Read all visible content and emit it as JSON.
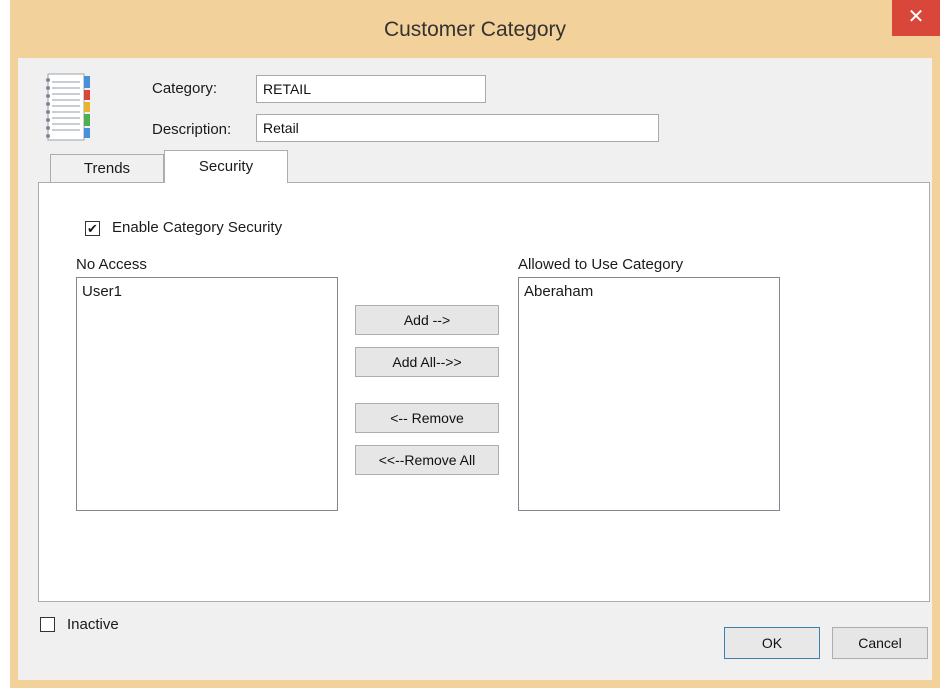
{
  "window": {
    "title": "Customer Category",
    "close_glyph": "✕"
  },
  "form": {
    "category_label": "Category:",
    "category_value": "RETAIL",
    "description_label": "Description:",
    "description_value": "Retail"
  },
  "tabs": [
    {
      "label": "Trends",
      "active": false
    },
    {
      "label": "Security",
      "active": true
    }
  ],
  "security": {
    "enable_label": "Enable Category Security",
    "enable_checked": true,
    "no_access_label": "No Access",
    "no_access_items": [
      "User1"
    ],
    "allowed_label": "Allowed to Use Category",
    "allowed_items": [
      "Aberaham"
    ],
    "add_label": "Add -->",
    "add_all_label": "Add All-->>",
    "remove_label": "<-- Remove",
    "remove_all_label": "<<--Remove All"
  },
  "footer": {
    "inactive_label": "Inactive",
    "inactive_checked": false,
    "ok_label": "OK",
    "cancel_label": "Cancel"
  },
  "icons": {
    "app_icon": "notebook-icon",
    "checkmark": "✔"
  },
  "colors": {
    "titlebar": "#f3d19a",
    "close": "#d9463a",
    "accent": "#3c7fb1"
  }
}
